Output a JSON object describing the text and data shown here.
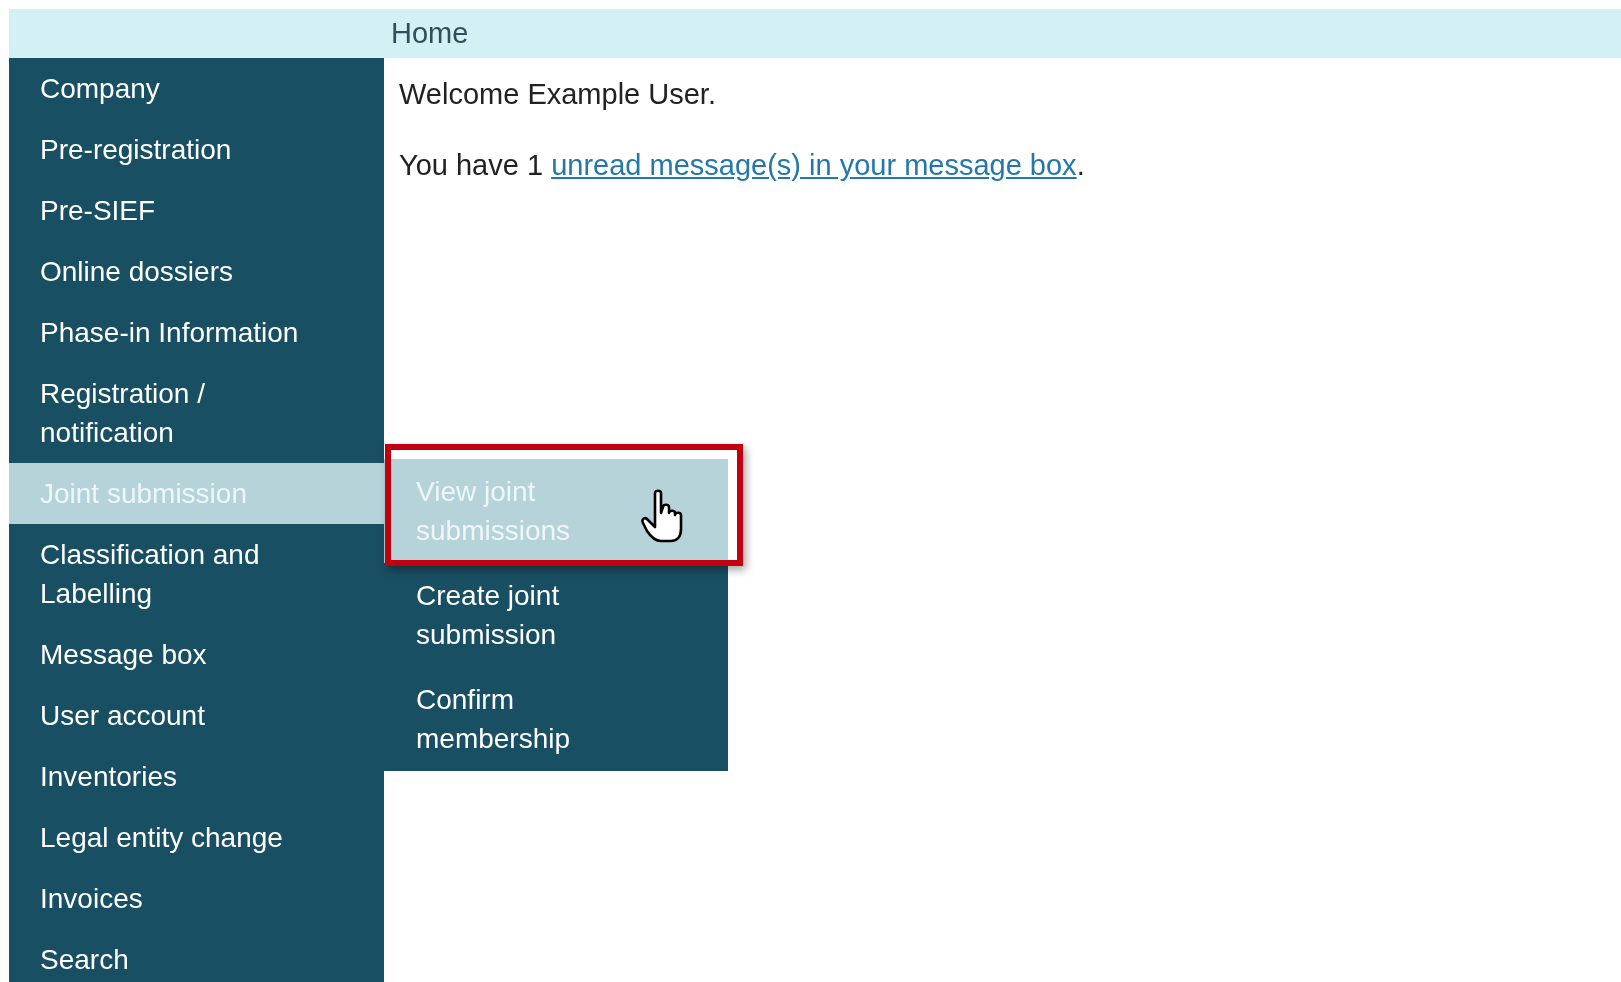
{
  "header": {
    "title": "Home"
  },
  "sidebar": {
    "items": [
      {
        "label": "Company",
        "selected": false
      },
      {
        "label": "Pre-registration",
        "selected": false
      },
      {
        "label": "Pre-SIEF",
        "selected": false
      },
      {
        "label": "Online dossiers",
        "selected": false
      },
      {
        "label": "Phase-in Information",
        "selected": false
      },
      {
        "label": "Registration / notification",
        "selected": false
      },
      {
        "label": "Joint submission",
        "selected": true
      },
      {
        "label": "Classification and Labelling",
        "selected": false
      },
      {
        "label": "Message box",
        "selected": false
      },
      {
        "label": "User account",
        "selected": false
      },
      {
        "label": "Inventories",
        "selected": false
      },
      {
        "label": "Legal entity change",
        "selected": false
      },
      {
        "label": "Invoices",
        "selected": false
      },
      {
        "label": "Search",
        "selected": false
      }
    ]
  },
  "submenu": {
    "items": [
      {
        "label": "View joint submissions",
        "selected": true
      },
      {
        "label": "Create joint submission",
        "selected": false
      },
      {
        "label": "Confirm membership",
        "selected": false
      }
    ]
  },
  "content": {
    "welcome": "Welcome Example User.",
    "message_prefix": "You have 1",
    "message_link": "unread message(s) in your message box",
    "message_suffix": "."
  }
}
